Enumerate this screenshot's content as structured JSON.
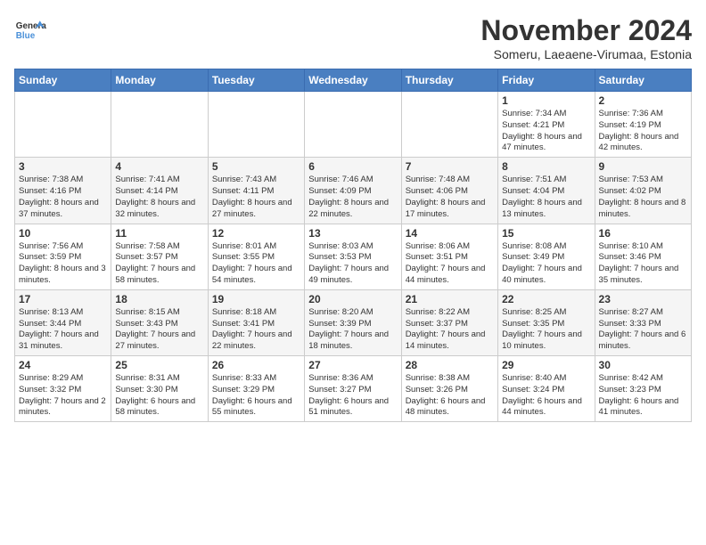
{
  "logo": {
    "line1": "General",
    "line2": "Blue"
  },
  "title": "November 2024",
  "location": "Someru, Laeaene-Virumaa, Estonia",
  "days_of_week": [
    "Sunday",
    "Monday",
    "Tuesday",
    "Wednesday",
    "Thursday",
    "Friday",
    "Saturday"
  ],
  "weeks": [
    [
      {
        "day": "",
        "info": ""
      },
      {
        "day": "",
        "info": ""
      },
      {
        "day": "",
        "info": ""
      },
      {
        "day": "",
        "info": ""
      },
      {
        "day": "",
        "info": ""
      },
      {
        "day": "1",
        "info": "Sunrise: 7:34 AM\nSunset: 4:21 PM\nDaylight: 8 hours and 47 minutes."
      },
      {
        "day": "2",
        "info": "Sunrise: 7:36 AM\nSunset: 4:19 PM\nDaylight: 8 hours and 42 minutes."
      }
    ],
    [
      {
        "day": "3",
        "info": "Sunrise: 7:38 AM\nSunset: 4:16 PM\nDaylight: 8 hours and 37 minutes."
      },
      {
        "day": "4",
        "info": "Sunrise: 7:41 AM\nSunset: 4:14 PM\nDaylight: 8 hours and 32 minutes."
      },
      {
        "day": "5",
        "info": "Sunrise: 7:43 AM\nSunset: 4:11 PM\nDaylight: 8 hours and 27 minutes."
      },
      {
        "day": "6",
        "info": "Sunrise: 7:46 AM\nSunset: 4:09 PM\nDaylight: 8 hours and 22 minutes."
      },
      {
        "day": "7",
        "info": "Sunrise: 7:48 AM\nSunset: 4:06 PM\nDaylight: 8 hours and 17 minutes."
      },
      {
        "day": "8",
        "info": "Sunrise: 7:51 AM\nSunset: 4:04 PM\nDaylight: 8 hours and 13 minutes."
      },
      {
        "day": "9",
        "info": "Sunrise: 7:53 AM\nSunset: 4:02 PM\nDaylight: 8 hours and 8 minutes."
      }
    ],
    [
      {
        "day": "10",
        "info": "Sunrise: 7:56 AM\nSunset: 3:59 PM\nDaylight: 8 hours and 3 minutes."
      },
      {
        "day": "11",
        "info": "Sunrise: 7:58 AM\nSunset: 3:57 PM\nDaylight: 7 hours and 58 minutes."
      },
      {
        "day": "12",
        "info": "Sunrise: 8:01 AM\nSunset: 3:55 PM\nDaylight: 7 hours and 54 minutes."
      },
      {
        "day": "13",
        "info": "Sunrise: 8:03 AM\nSunset: 3:53 PM\nDaylight: 7 hours and 49 minutes."
      },
      {
        "day": "14",
        "info": "Sunrise: 8:06 AM\nSunset: 3:51 PM\nDaylight: 7 hours and 44 minutes."
      },
      {
        "day": "15",
        "info": "Sunrise: 8:08 AM\nSunset: 3:49 PM\nDaylight: 7 hours and 40 minutes."
      },
      {
        "day": "16",
        "info": "Sunrise: 8:10 AM\nSunset: 3:46 PM\nDaylight: 7 hours and 35 minutes."
      }
    ],
    [
      {
        "day": "17",
        "info": "Sunrise: 8:13 AM\nSunset: 3:44 PM\nDaylight: 7 hours and 31 minutes."
      },
      {
        "day": "18",
        "info": "Sunrise: 8:15 AM\nSunset: 3:43 PM\nDaylight: 7 hours and 27 minutes."
      },
      {
        "day": "19",
        "info": "Sunrise: 8:18 AM\nSunset: 3:41 PM\nDaylight: 7 hours and 22 minutes."
      },
      {
        "day": "20",
        "info": "Sunrise: 8:20 AM\nSunset: 3:39 PM\nDaylight: 7 hours and 18 minutes."
      },
      {
        "day": "21",
        "info": "Sunrise: 8:22 AM\nSunset: 3:37 PM\nDaylight: 7 hours and 14 minutes."
      },
      {
        "day": "22",
        "info": "Sunrise: 8:25 AM\nSunset: 3:35 PM\nDaylight: 7 hours and 10 minutes."
      },
      {
        "day": "23",
        "info": "Sunrise: 8:27 AM\nSunset: 3:33 PM\nDaylight: 7 hours and 6 minutes."
      }
    ],
    [
      {
        "day": "24",
        "info": "Sunrise: 8:29 AM\nSunset: 3:32 PM\nDaylight: 7 hours and 2 minutes."
      },
      {
        "day": "25",
        "info": "Sunrise: 8:31 AM\nSunset: 3:30 PM\nDaylight: 6 hours and 58 minutes."
      },
      {
        "day": "26",
        "info": "Sunrise: 8:33 AM\nSunset: 3:29 PM\nDaylight: 6 hours and 55 minutes."
      },
      {
        "day": "27",
        "info": "Sunrise: 8:36 AM\nSunset: 3:27 PM\nDaylight: 6 hours and 51 minutes."
      },
      {
        "day": "28",
        "info": "Sunrise: 8:38 AM\nSunset: 3:26 PM\nDaylight: 6 hours and 48 minutes."
      },
      {
        "day": "29",
        "info": "Sunrise: 8:40 AM\nSunset: 3:24 PM\nDaylight: 6 hours and 44 minutes."
      },
      {
        "day": "30",
        "info": "Sunrise: 8:42 AM\nSunset: 3:23 PM\nDaylight: 6 hours and 41 minutes."
      }
    ]
  ]
}
